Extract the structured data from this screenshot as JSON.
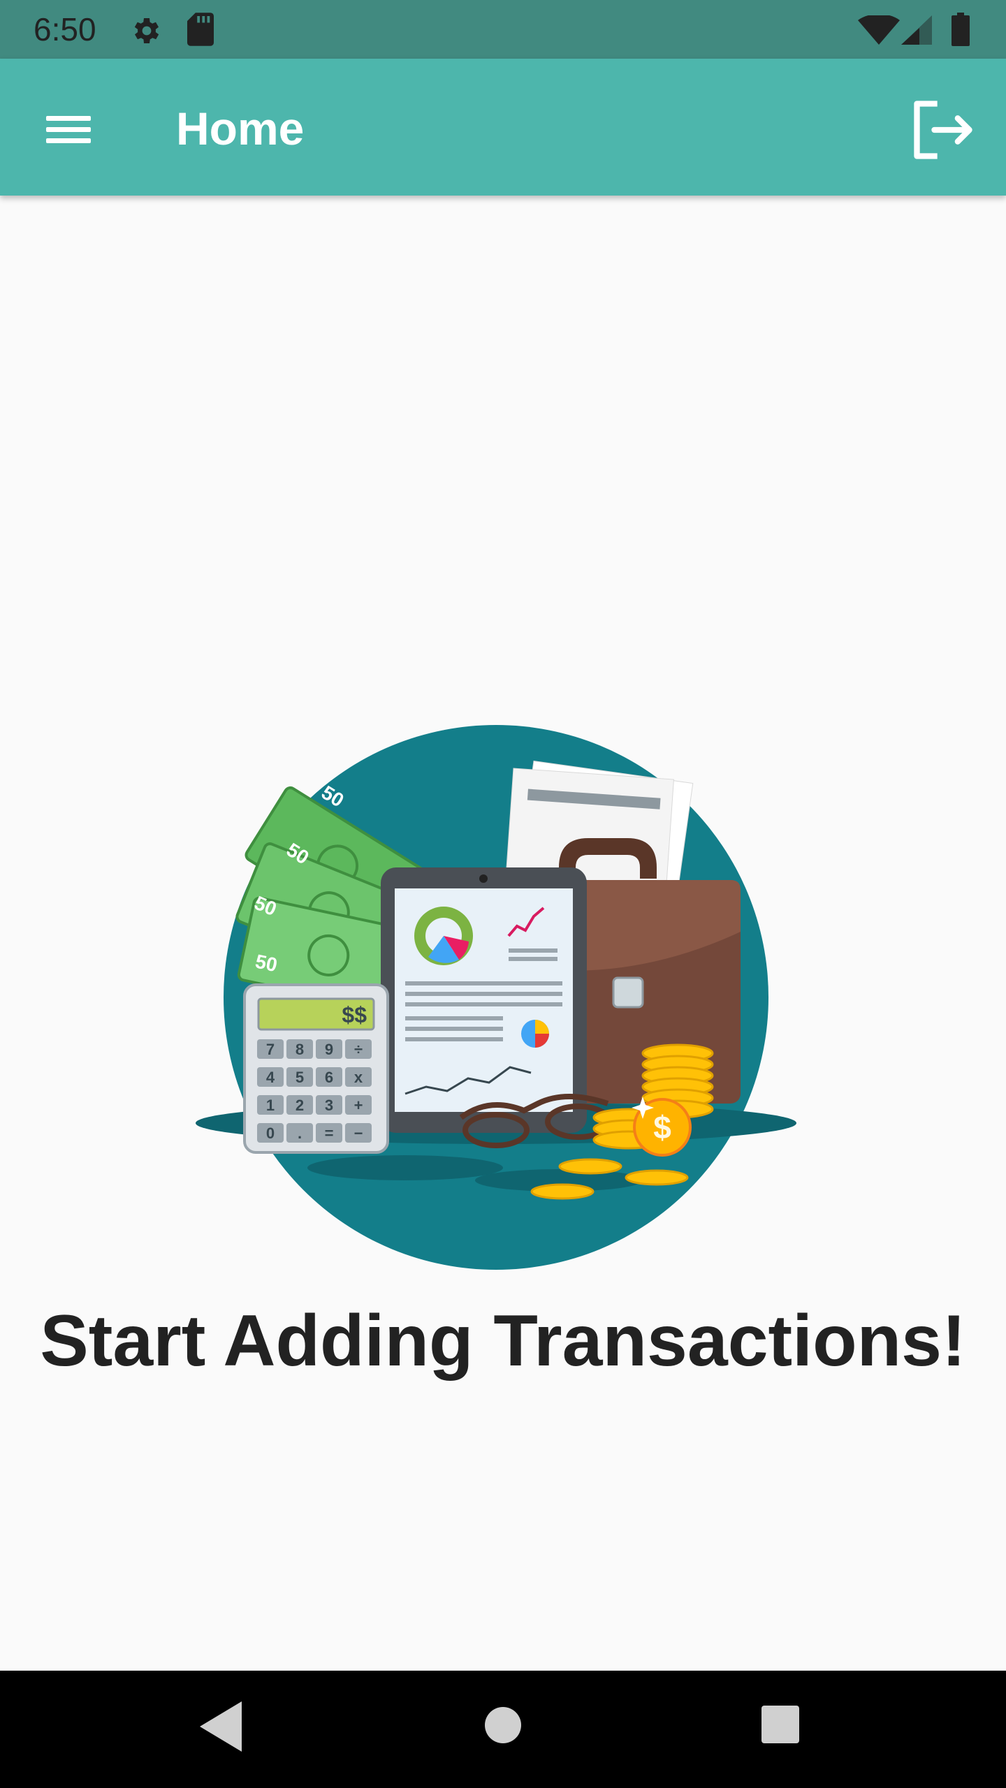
{
  "status_bar": {
    "time": "6:50",
    "icons": [
      "settings-gear-icon",
      "sd-card-icon",
      "wifi-icon",
      "cell-signal-icon",
      "battery-icon"
    ]
  },
  "app_bar": {
    "title": "Home",
    "menu_icon": "hamburger-menu-icon",
    "logout_icon": "logout-icon",
    "color": "#4db6ac"
  },
  "main": {
    "illustration": {
      "icon": "finance-illustration",
      "bill_labels": [
        "50",
        "50",
        "50",
        "50"
      ],
      "calculator_display": "$$",
      "calculator_keys": [
        "7",
        "8",
        "9",
        "÷",
        "4",
        "5",
        "6",
        "x",
        "1",
        "2",
        "3",
        "+",
        "0",
        ".",
        "=",
        "−"
      ]
    },
    "empty_state_title": "Start Adding Transactions!"
  },
  "nav_bar": {
    "buttons": [
      "back-icon",
      "home-icon",
      "recents-icon"
    ]
  }
}
